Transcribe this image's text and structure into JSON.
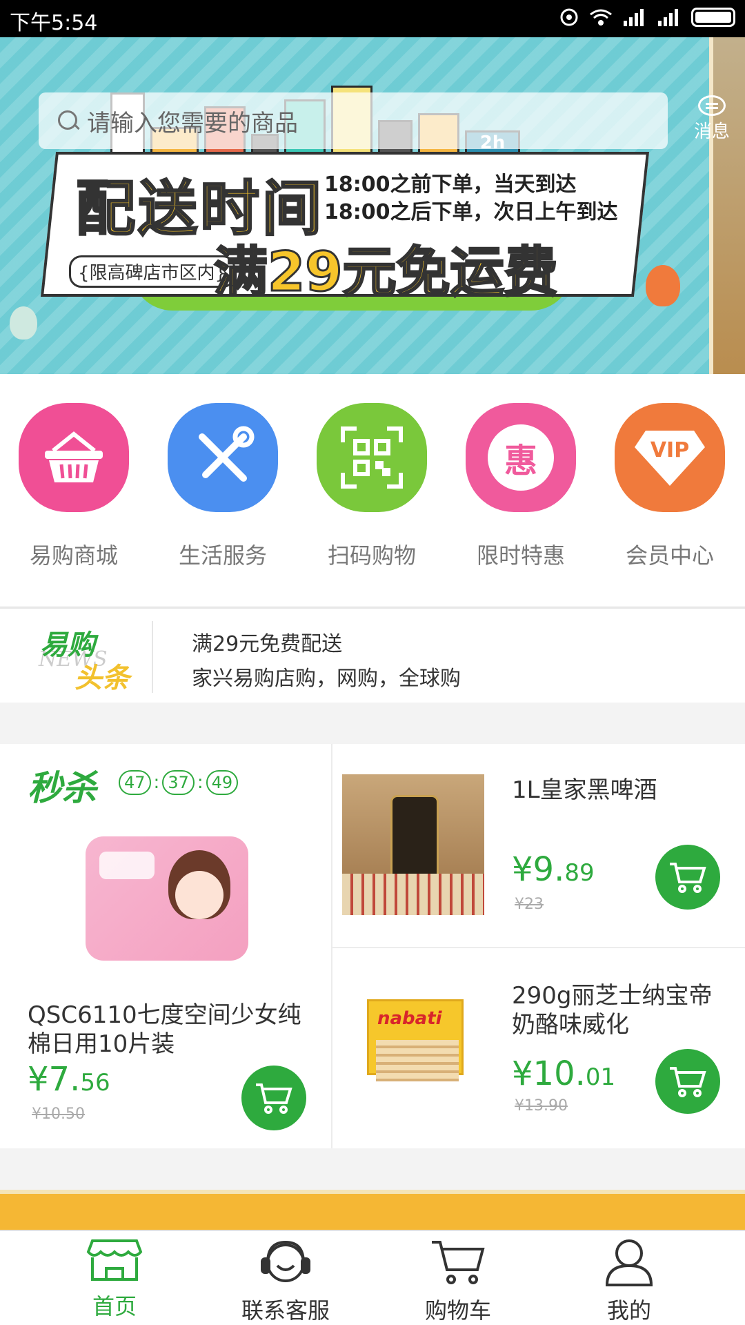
{
  "status_bar": {
    "time": "下午5:54"
  },
  "header": {
    "search_placeholder": "请输入您需要的商品",
    "message_label": "消息"
  },
  "banner": {
    "headline": "配送时间",
    "line1": "18:00之前下单，当天到达",
    "line2": "18:00之后下单，次日上午到达",
    "limit_note": "{限高碑店市区内}",
    "offer": "满29元免运费",
    "truck_badge": "2h",
    "slide_count": 4,
    "active_slide": 1
  },
  "quick_menu": [
    {
      "label": "易购商城",
      "icon": "basket-icon",
      "color": "#f04f95"
    },
    {
      "label": "生活服务",
      "icon": "tools-icon",
      "color": "#4b8ff0"
    },
    {
      "label": "扫码购物",
      "icon": "qr-scan-icon",
      "color": "#7ac83b"
    },
    {
      "label": "限时特惠",
      "icon": "discount-badge-icon",
      "color": "#f05a9c",
      "glyph": "惠"
    },
    {
      "label": "会员中心",
      "icon": "vip-diamond-icon",
      "color": "#f07a3c",
      "glyph": "VIP"
    }
  ],
  "news": {
    "logo_top": "易购",
    "logo_bottom": "头条",
    "logo_watermark": "NEWS",
    "line1": "满29元免费配送",
    "line2": "家兴易购店购，网购，全球购"
  },
  "flash_sale": {
    "title": "秒杀",
    "timer": [
      "47",
      "37",
      "49"
    ],
    "featured": {
      "name": "QSC6110七度空间少女纯棉日用10片装",
      "price_main": "¥7.",
      "price_cents": "56",
      "old_price": "¥10.50"
    },
    "side_items": [
      {
        "name": "1L皇家黑啤酒",
        "price_main": "¥9.",
        "price_cents": "89",
        "old_price": "¥23"
      },
      {
        "name": "290g丽芝士纳宝帝奶酪味威化",
        "price_main": "¥10.",
        "price_cents": "01",
        "old_price": "¥13.90"
      }
    ]
  },
  "tab_bar": [
    {
      "label": "首页",
      "icon": "storefront-icon",
      "active": true
    },
    {
      "label": "联系客服",
      "icon": "headset-icon",
      "active": false
    },
    {
      "label": "购物车",
      "icon": "cart-icon",
      "active": false
    },
    {
      "label": "我的",
      "icon": "person-icon",
      "active": false
    }
  ],
  "colors": {
    "brand_green": "#2eaa3e",
    "accent_yellow": "#f7c52b"
  }
}
